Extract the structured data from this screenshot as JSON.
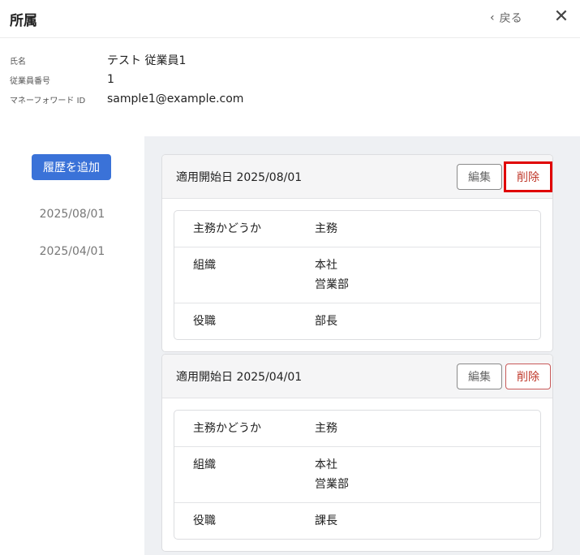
{
  "header": {
    "title": "所属",
    "back_label": "戻る"
  },
  "employee": {
    "fields": [
      {
        "label": "氏名",
        "value": "テスト 従業員1"
      },
      {
        "label": "従業員番号",
        "value": "1"
      },
      {
        "label": "マネーフォワード ID",
        "value": "sample1@example.com"
      }
    ]
  },
  "history": {
    "add_button": "履歴を追加",
    "dates": [
      "2025/08/01",
      "2025/04/01"
    ]
  },
  "cards": [
    {
      "date_label": "適用開始日 2025/08/01",
      "edit_label": "編集",
      "delete_label": "削除",
      "rows": {
        "main_label": "主務かどうか",
        "main_value": "主務",
        "org_label": "組織",
        "org_value_1": "本社",
        "org_value_2": "営業部",
        "pos_label": "役職",
        "pos_value": "部長"
      }
    },
    {
      "date_label": "適用開始日 2025/04/01",
      "edit_label": "編集",
      "delete_label": "削除",
      "rows": {
        "main_label": "主務かどうか",
        "main_value": "主務",
        "org_label": "組織",
        "org_value_1": "本社",
        "org_value_2": "営業部",
        "pos_label": "役職",
        "pos_value": "課長"
      }
    }
  ],
  "colors": {
    "primary": "#3a72d8",
    "danger": "#c0392b",
    "highlight": "#e00000",
    "panel_bg": "#eef0f3"
  },
  "icons": {
    "back": "chevron-left-icon",
    "close": "close-icon"
  }
}
